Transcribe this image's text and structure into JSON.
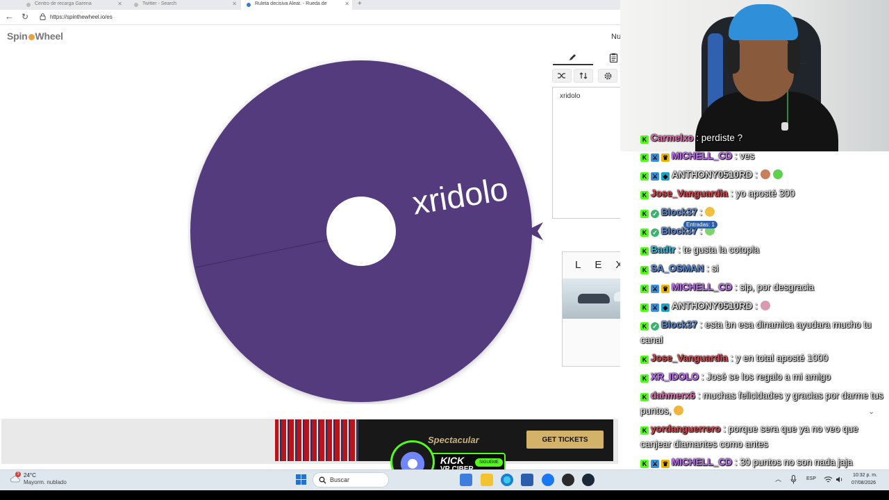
{
  "browser": {
    "tabs": [
      {
        "label": "Centro de recarga Garena"
      },
      {
        "label": "Twitter - Search"
      },
      {
        "label": "Ruleta decisiva Aleat. - Rueda de"
      }
    ],
    "url": "https://spinthewheel.io/es"
  },
  "page": {
    "logo_part1": "Spin",
    "logo_part2": "Wheel",
    "header_partial": "Nu",
    "entries_text": "xridolo",
    "wheel_label": "xridolo",
    "wheel_color": "#533a7d",
    "entries_counter": "Entradas: 1"
  },
  "ads": {
    "lexus_word": "LEXUS",
    "banner_title": "Spectacular",
    "banner_button": "GET TICKETS"
  },
  "kick_badge": {
    "title": "KICK",
    "subtitle": "VR CIBER",
    "follow": "SIGUEME"
  },
  "chat": {
    "messages": [
      {
        "user": "Carmelxo",
        "color": "#e56fb0",
        "text": ": perdiste ?",
        "badges": [
          "k"
        ]
      },
      {
        "user": "MICHELL_CD",
        "color": "#c36ef7",
        "text": ": ves",
        "badges": [
          "k",
          "mod",
          "sub"
        ]
      },
      {
        "user": "ANTHONY0510RD",
        "color": "#dcdcdc",
        "text": ":",
        "badges": [
          "k",
          "mod",
          "vip"
        ],
        "emojis": [
          "#c7805a",
          "#5fcf4f"
        ]
      },
      {
        "user": "Jose_Vanguardia",
        "color": "#e3434c",
        "text": ": yo aposté 300",
        "badges": [
          "k"
        ]
      },
      {
        "user": "Block37",
        "color": "#5b8bd8",
        "text": ":",
        "badges": [
          "k",
          "verif"
        ],
        "emojis": [
          "#f0c040"
        ]
      },
      {
        "user": "Block37",
        "color": "#5b8bd8",
        "text": ":",
        "badges": [
          "k",
          "verif"
        ],
        "emojis": [
          "#7cd46a"
        ]
      },
      {
        "user": "Badtr",
        "color": "#33c6e0",
        "text": ": te gusta la cotopla",
        "badges": [
          "k"
        ]
      },
      {
        "user": "SA_OSMAN",
        "color": "#5b8bd8",
        "text": ": si",
        "badges": [
          "k"
        ]
      },
      {
        "user": "MICHELL_CD",
        "color": "#c36ef7",
        "text": ": sip, por desgracia",
        "badges": [
          "k",
          "mod",
          "sub"
        ]
      },
      {
        "user": "ANTHONY0510RD",
        "color": "#dcdcdc",
        "text": ":",
        "badges": [
          "k",
          "mod",
          "vip"
        ],
        "emojis": [
          "#d89ab0"
        ]
      },
      {
        "user": "Block37",
        "color": "#5b8bd8",
        "text": ": esta bn esa dinamica ayudara mucho tu canal",
        "badges": [
          "k",
          "verif"
        ]
      },
      {
        "user": "Jose_Vanguardia",
        "color": "#e3434c",
        "text": ": y en total aposté 1000",
        "badges": [
          "k"
        ]
      },
      {
        "user": "XR_IDOLO",
        "color": "#c36ef7",
        "text": ": José se los regalo a mi amigo",
        "badges": [
          "k"
        ]
      },
      {
        "user": "dahmerx6",
        "color": "#e56fb0",
        "text": ": muchas felicidades y gracias por darme tus puntos,",
        "badges": [
          "k"
        ],
        "emojis": [
          "#f2b53a"
        ]
      },
      {
        "user": "yordanguerrero",
        "color": "#e3434c",
        "text": ": porque sera que ya no veo que canjear diamantes como antes",
        "badges": [
          "k"
        ]
      },
      {
        "user": "MICHELL_CD",
        "color": "#c36ef7",
        "text": ": 30 puntos no son nada jaja",
        "badges": [
          "k",
          "mod",
          "sub"
        ]
      }
    ]
  },
  "taskbar": {
    "temperature": "24°C",
    "weather": "Mayorm. nublado",
    "notification_count": "3",
    "search_label": "Buscar",
    "language": "ESP",
    "time": "10:32 p. m.",
    "date": "07/08/2026"
  }
}
